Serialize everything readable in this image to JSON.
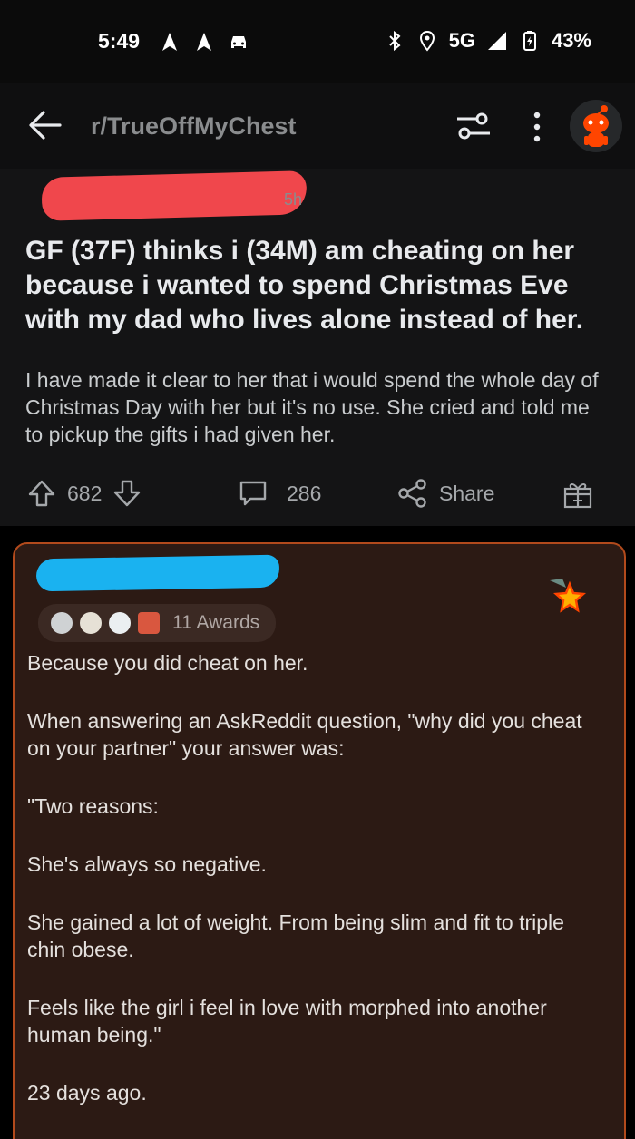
{
  "status_bar": {
    "time": "5:49",
    "network": "5G",
    "battery": "43%",
    "icons_left": [
      "nav-arrow-icon",
      "nav-arrow-icon",
      "car-icon"
    ],
    "icons_right": [
      "bluetooth-icon",
      "location-icon",
      "signal-icon",
      "battery-charging-icon"
    ]
  },
  "header": {
    "subreddit": "r/TrueOffMyChest",
    "icons": [
      "back-arrow-icon",
      "filter-icon",
      "more-icon",
      "avatar-icon"
    ]
  },
  "post": {
    "age": "5h",
    "title": "GF (37F) thinks i (34M) am cheating on her because i wanted to spend Christmas Eve with my dad who lives alone instead of her.",
    "body": "I have made it clear to her that i would spend the whole day of Christmas Day with her but it's no use. She cried and told me to pickup the gifts i had given her.",
    "votes": "682",
    "comments": "286",
    "share_label": "Share",
    "colors": {
      "redaction": "#f0474c"
    }
  },
  "comment": {
    "awards_label": "11 Awards",
    "paragraphs": [
      "Because you did cheat on her.",
      "When answering an AskReddit question, \"why did you cheat on your partner\" your answer was:",
      "\"Two reasons:",
      "She's always so negative.",
      "She gained a lot of weight. From being slim and fit to triple chin obese.",
      "Feels like the girl i feel in love with morphed into another human being.\"",
      "23 days ago."
    ],
    "colors": {
      "background": "#2c1a14",
      "border": "#b24a1c",
      "redaction": "#1ab2f0"
    }
  }
}
